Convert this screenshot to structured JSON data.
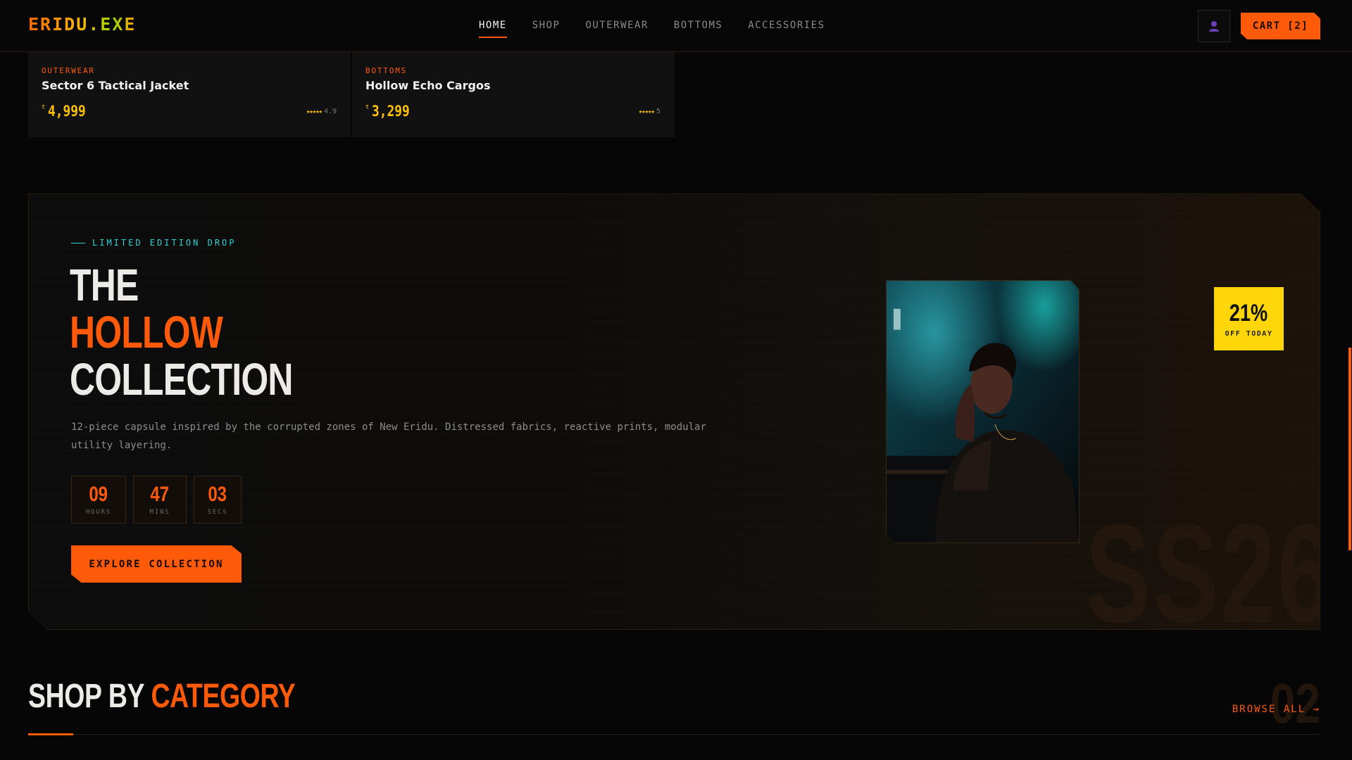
{
  "header": {
    "logo": "ERIDU.EXE",
    "nav": [
      "HOME",
      "SHOP",
      "OUTERWEAR",
      "BOTTOMS",
      "ACCESSORIES"
    ],
    "active_nav": "HOME",
    "account_icon": "user-icon",
    "cart_label": "CART [2]"
  },
  "products": [
    {
      "category": "OUTERWEAR",
      "name": "Sector 6 Tactical Jacket",
      "currency": "₹",
      "price": "4,999",
      "stars": "★★★★★",
      "rating": "4.9"
    },
    {
      "category": "BOTTOMS",
      "name": "Hollow Echo Cargos",
      "currency": "₹",
      "price": "3,299",
      "stars": "★★★★★",
      "rating": "5"
    }
  ],
  "promo": {
    "eyebrow": "LIMITED EDITION DROP",
    "title_line1": "THE",
    "title_line2": "HOLLOW",
    "title_line3": "COLLECTION",
    "description": "12-piece capsule inspired by the corrupted zones of New Eridu. Distressed fabrics, reactive prints, modular utility layering.",
    "countdown": [
      {
        "value": "09",
        "label": "HOURS"
      },
      {
        "value": "47",
        "label": "MINS"
      },
      {
        "value": "03",
        "label": "SECS"
      }
    ],
    "cta": "EXPLORE COLLECTION",
    "watermark": "SS26",
    "discount_value": "21%",
    "discount_label": "OFF TODAY"
  },
  "category_section": {
    "title_white": "SHOP BY",
    "title_orange": "CATEGORY",
    "section_number": "02",
    "browse_all": "BROWSE ALL →"
  },
  "colors": {
    "accent": "#ff5a0a",
    "price": "#ffc107",
    "badge": "#ffd60a",
    "eyebrow": "#2fd3d3",
    "background": "#060606"
  }
}
